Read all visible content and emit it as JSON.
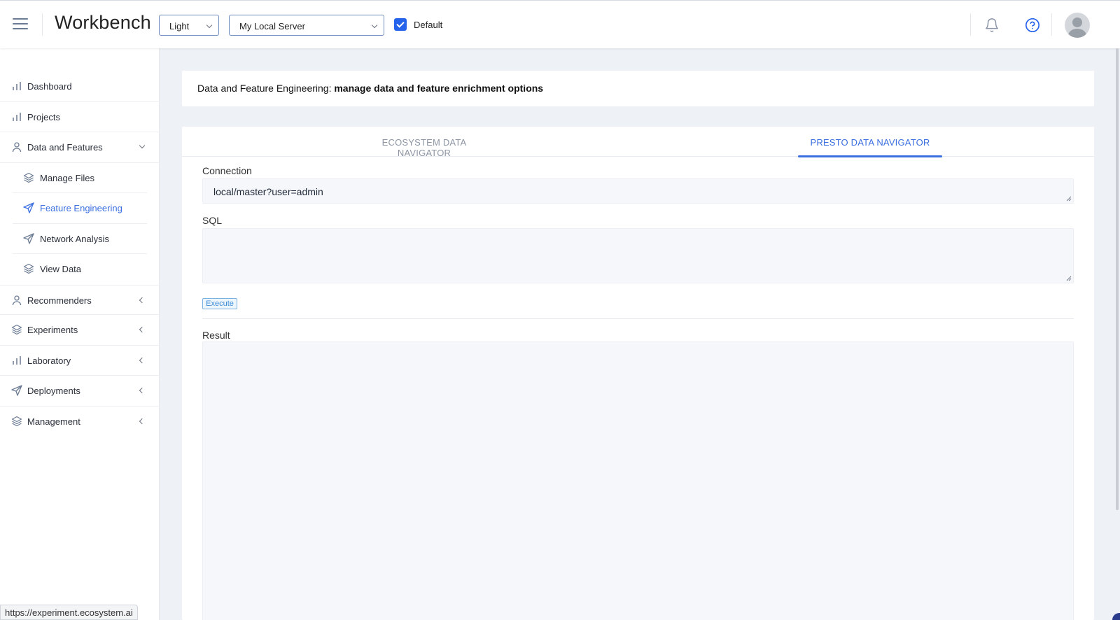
{
  "app": {
    "title": "Workbench",
    "accent_color": "#3b6fe0"
  },
  "topbar": {
    "theme_select": {
      "value": "Light"
    },
    "server_select": {
      "value": "My Local Server"
    },
    "default_checkbox": {
      "label": "Default",
      "checked": true
    },
    "icons": [
      "menu-icon",
      "bell-icon",
      "help-icon",
      "avatar"
    ]
  },
  "sidebar": {
    "items": [
      {
        "label": "Dashboard",
        "icon": "bar-chart-icon"
      },
      {
        "label": "Projects",
        "icon": "bar-chart-icon"
      },
      {
        "label": "Data and Features",
        "icon": "user-icon",
        "expanded": true,
        "children": [
          {
            "label": "Manage Files",
            "icon": "layers-icon"
          },
          {
            "label": "Feature Engineering",
            "icon": "send-icon",
            "active": true
          },
          {
            "label": "Network Analysis",
            "icon": "send-icon"
          },
          {
            "label": "View Data",
            "icon": "layers-icon"
          }
        ]
      },
      {
        "label": "Recommenders",
        "icon": "user-icon"
      },
      {
        "label": "Experiments",
        "icon": "layers-icon"
      },
      {
        "label": "Laboratory",
        "icon": "bar-chart-icon"
      },
      {
        "label": "Deployments",
        "icon": "send-icon"
      },
      {
        "label": "Management",
        "icon": "layers-icon"
      }
    ]
  },
  "header": {
    "prefix": "Data and Feature Engineering:",
    "title": "manage data and feature enrichment options"
  },
  "tabs": [
    {
      "label": "ECOSYSTEM DATA NAVIGATOR",
      "active": false
    },
    {
      "label": "PRESTO DATA NAVIGATOR",
      "active": true
    }
  ],
  "form": {
    "connection_label": "Connection",
    "connection_value": "local/master?user=admin",
    "sql_label": "SQL",
    "sql_value": "",
    "execute_label": "Execute",
    "result_label": "Result",
    "result_value": ""
  },
  "status_bar": {
    "url": "https://experiment.ecosystem.ai"
  }
}
